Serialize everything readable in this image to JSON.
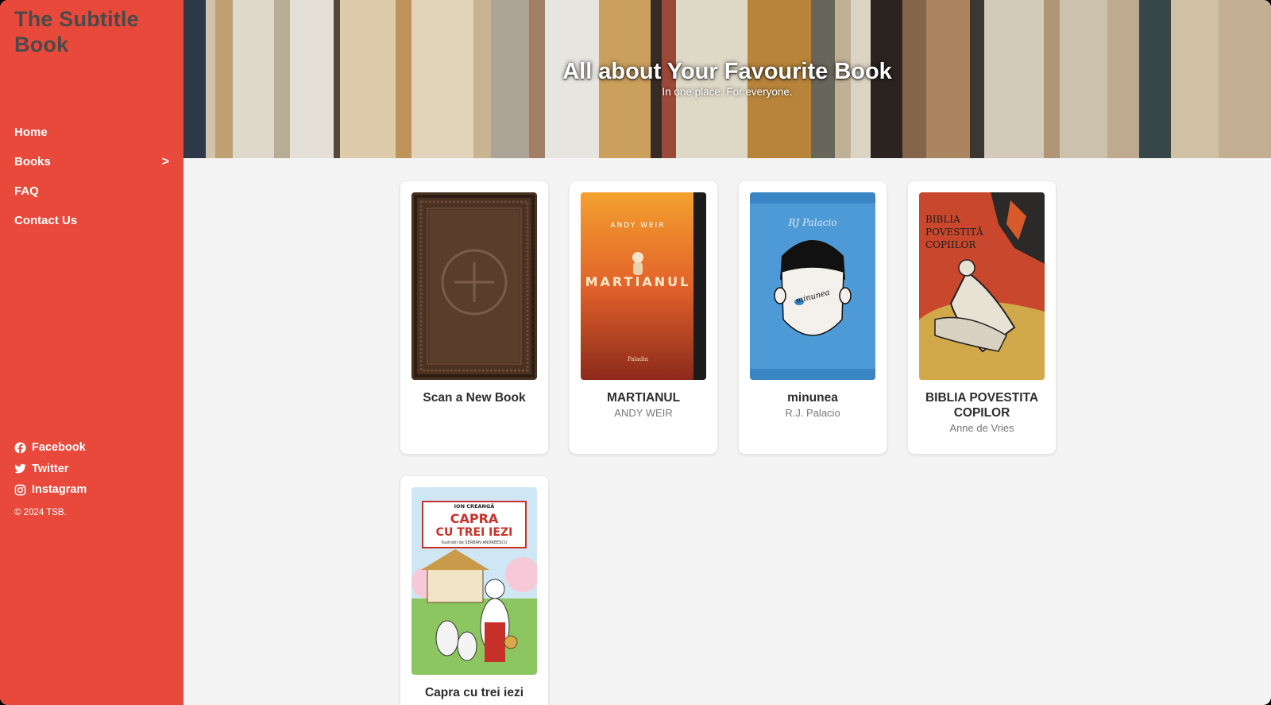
{
  "brand": {
    "title": "The Subtitle Book"
  },
  "nav": {
    "items": [
      {
        "label": "Home",
        "has_submenu": false
      },
      {
        "label": "Books",
        "has_submenu": true,
        "chevron": ">"
      },
      {
        "label": "FAQ",
        "has_submenu": false
      },
      {
        "label": "Contact Us",
        "has_submenu": false
      }
    ]
  },
  "social": [
    {
      "label": "Facebook",
      "icon": "facebook-icon"
    },
    {
      "label": "Twitter",
      "icon": "twitter-icon"
    },
    {
      "label": "Instagram",
      "icon": "instagram-icon"
    }
  ],
  "footer": {
    "copyright": "© 2024 TSB."
  },
  "hero": {
    "title": "All about Your Favourite Book",
    "subtitle": "In one place. For everyone."
  },
  "books": [
    {
      "title": "Scan a New Book",
      "author": "",
      "cover": "add-book-cover"
    },
    {
      "title": "MARTIANUL",
      "author": "ANDY WEIR",
      "cover": "martianul-cover",
      "cover_text": {
        "author": "ANDY WEIR",
        "title": "MARTIANUL"
      }
    },
    {
      "title": "minunea",
      "author": "R.J. Palacio",
      "cover": "minunea-cover",
      "cover_text": {
        "author": "RJ Palacio",
        "title": "minunea"
      }
    },
    {
      "title": "BIBLIA POVESTITA COPILOR",
      "author": "Anne de Vries",
      "cover": "biblia-cover",
      "cover_text": {
        "title": "BIBLIA POVESTITĂ COPIILOR"
      }
    },
    {
      "title": "Capra cu trei iezi",
      "author": "",
      "cover": "capra-cover",
      "cover_text": {
        "author": "ION CREANGĂ",
        "title_line1": "CAPRA",
        "title_line2": "CU TREI IEZI",
        "illustrator": "Ilustrații de ȘERBAN ANDREESCU"
      }
    }
  ],
  "colors": {
    "sidebar": "#e8493b",
    "background": "#f4f4f4",
    "brand_text": "#4a4a4a"
  }
}
